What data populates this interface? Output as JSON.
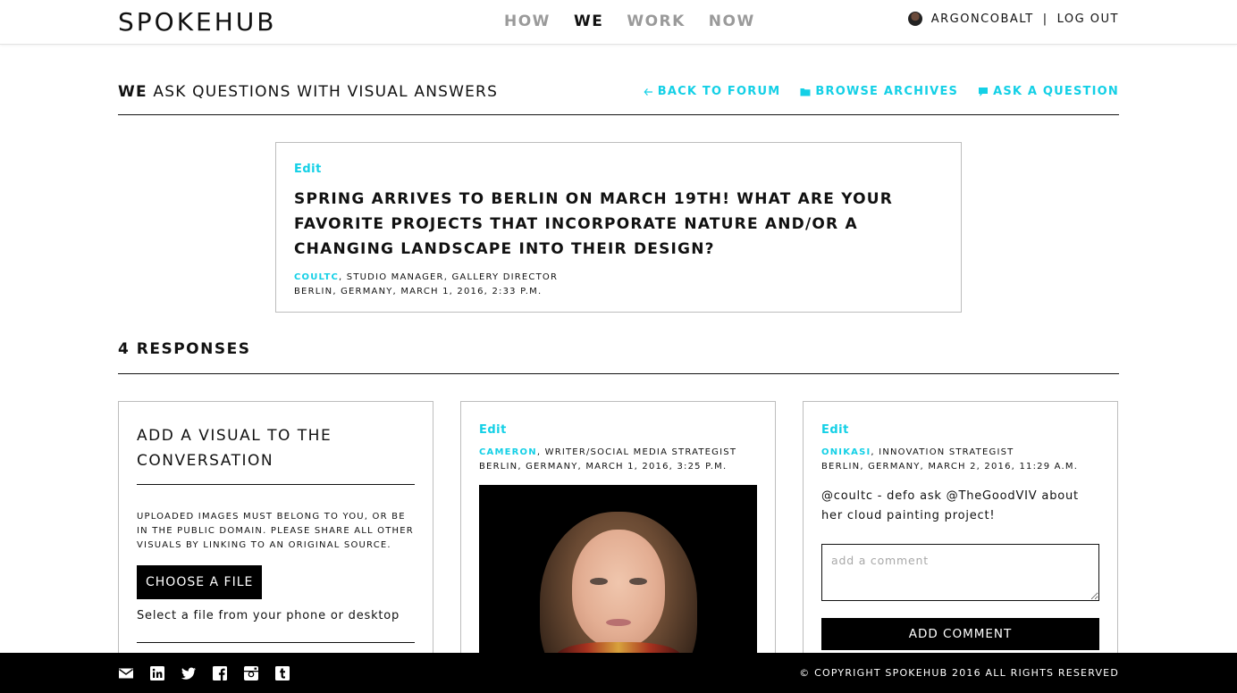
{
  "colors": {
    "accent": "#14d0e6",
    "text": "#111111",
    "nav_inactive": "#9a9a9a",
    "footer_bg": "#000000"
  },
  "header": {
    "logo": "SPOKEHUB",
    "nav": [
      {
        "label": "HOW",
        "active": false
      },
      {
        "label": "WE",
        "active": true
      },
      {
        "label": "WORK",
        "active": false
      },
      {
        "label": "NOW",
        "active": false
      }
    ],
    "username": "ARGONCOBALT",
    "separator": "|",
    "logout": "LOG OUT"
  },
  "page": {
    "title_bold": "WE",
    "title_rest": " ASK QUESTIONS WITH VISUAL ANSWERS",
    "links": {
      "back": {
        "label": "BACK TO FORUM",
        "icon": "arrow-left-icon"
      },
      "archives": {
        "label": "BROWSE ARCHIVES",
        "icon": "folder-icon"
      },
      "ask": {
        "label": "ASK A QUESTION",
        "icon": "chat-bubble-icon"
      }
    }
  },
  "question": {
    "edit_label": "Edit",
    "text": "SPRING ARRIVES TO BERLIN ON MARCH 19TH! WHAT ARE YOUR FAVORITE PROJECTS THAT INCORPORATE NATURE AND/OR A CHANGING LANDSCAPE INTO THEIR DESIGN?",
    "author": "COULTC",
    "author_role": ", STUDIO MANAGER, GALLERY DIRECTOR",
    "location_date": "BERLIN, GERMANY, MARCH 1, 2016, 2:33 P.M."
  },
  "responses": {
    "count_label": "4 RESPONSES",
    "add_visual": {
      "title": "ADD A VISUAL TO THE CONVERSATION",
      "note": "UPLOADED IMAGES MUST BELONG TO YOU, OR BE IN THE PUBLIC DOMAIN. PLEASE SHARE ALL OTHER VISUALS BY LINKING TO AN ORIGINAL SOURCE.",
      "button": "CHOOSE A FILE",
      "select_note": "Select a file from your phone or desktop"
    },
    "items": [
      {
        "edit_label": "Edit",
        "author": "CAMERON",
        "author_role": ", WRITER/SOCIAL MEDIA STRATEGIST",
        "location_date": "BERLIN, GERMANY, MARCH 1, 2016, 3:25 P.M.",
        "image": "portrait-photo"
      },
      {
        "edit_label": "Edit",
        "author": "ONIKASI",
        "author_role": ", INNOVATION STRATEGIST",
        "location_date": "BERLIN, GERMANY, MARCH 2, 2016, 11:29 A.M.",
        "comment": "@coultc - defo ask @TheGoodVIV about her cloud painting project!",
        "comment_placeholder": "add a comment",
        "add_comment_button": "ADD COMMENT"
      }
    ]
  },
  "footer": {
    "social": [
      "mail-icon",
      "linkedin-icon",
      "twitter-icon",
      "facebook-icon",
      "instagram-icon",
      "tumblr-icon"
    ],
    "copyright": "© COPYRIGHT SPOKEHUB 2016 ALL RIGHTS RESERVED"
  }
}
